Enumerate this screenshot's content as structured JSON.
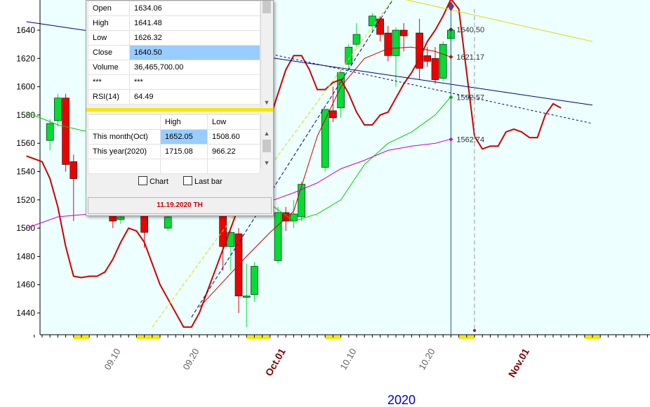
{
  "chart_data": {
    "type": "candlestick",
    "xlabel": "2020",
    "ylim": [
      1425,
      1662
    ],
    "y_ticks": [
      1440,
      1460,
      1480,
      1500,
      1520,
      1540,
      1560,
      1580,
      1600,
      1620,
      1640
    ],
    "x_ticks": [
      {
        "label": "09.10",
        "day": 10,
        "month": false
      },
      {
        "label": "09.20",
        "day": 20,
        "month": false
      },
      {
        "label": "Oct.01",
        "day": 31,
        "month": true
      },
      {
        "label": "10.10",
        "day": 40,
        "month": false
      },
      {
        "label": "10.20",
        "day": 50,
        "month": false
      },
      {
        "label": "Nov.01",
        "day": 62,
        "month": true
      }
    ],
    "candles": [
      {
        "day": 1,
        "open": 1562,
        "high": 1577,
        "low": 1555,
        "close": 1574
      },
      {
        "day": 2,
        "open": 1576,
        "high": 1595,
        "low": 1572,
        "close": 1592
      },
      {
        "day": 3,
        "open": 1592,
        "high": 1595,
        "low": 1540,
        "close": 1545
      },
      {
        "day": 4,
        "open": 1547,
        "high": 1552,
        "low": 1505,
        "close": 1535
      },
      {
        "day": 9,
        "open": 1509,
        "high": 1515,
        "low": 1500,
        "close": 1505
      },
      {
        "day": 10,
        "open": 1506,
        "high": 1512,
        "low": 1503,
        "close": 1508
      },
      {
        "day": 13,
        "open": 1510,
        "high": 1515,
        "low": 1486,
        "close": 1497
      },
      {
        "day": 16,
        "open": 1500,
        "high": 1512,
        "low": 1498,
        "close": 1508
      },
      {
        "day": 23,
        "open": 1513,
        "high": 1518,
        "low": 1470,
        "close": 1487
      },
      {
        "day": 24,
        "open": 1487,
        "high": 1498,
        "low": 1470,
        "close": 1497
      },
      {
        "day": 25,
        "open": 1496,
        "high": 1500,
        "low": 1440,
        "close": 1452
      },
      {
        "day": 26,
        "open": 1452,
        "high": 1475,
        "low": 1430,
        "close": 1452
      },
      {
        "day": 27,
        "open": 1453,
        "high": 1476,
        "low": 1448,
        "close": 1473
      },
      {
        "day": 30,
        "open": 1477,
        "high": 1515,
        "low": 1475,
        "close": 1511
      },
      {
        "day": 31,
        "open": 1511,
        "high": 1515,
        "low": 1498,
        "close": 1505
      },
      {
        "day": 32,
        "open": 1505,
        "high": 1520,
        "low": 1500,
        "close": 1510
      },
      {
        "day": 33,
        "open": 1508,
        "high": 1533,
        "low": 1505,
        "close": 1531
      },
      {
        "day": 36,
        "open": 1543,
        "high": 1575,
        "low": 1540,
        "close": 1584
      },
      {
        "day": 37,
        "open": 1583,
        "high": 1600,
        "low": 1575,
        "close": 1578
      },
      {
        "day": 38,
        "open": 1585,
        "high": 1612,
        "low": 1578,
        "close": 1610
      },
      {
        "day": 39,
        "open": 1616,
        "high": 1630,
        "low": 1612,
        "close": 1628
      },
      {
        "day": 40,
        "open": 1630,
        "high": 1645,
        "low": 1628,
        "close": 1637
      },
      {
        "day": 42,
        "open": 1643,
        "high": 1652,
        "low": 1638,
        "close": 1650
      },
      {
        "day": 43,
        "open": 1648,
        "high": 1650,
        "low": 1632,
        "close": 1637
      },
      {
        "day": 44,
        "open": 1638,
        "high": 1643,
        "low": 1618,
        "close": 1622
      },
      {
        "day": 45,
        "open": 1622,
        "high": 1642,
        "low": 1600,
        "close": 1640
      },
      {
        "day": 46,
        "open": 1640,
        "high": 1645,
        "low": 1625,
        "close": 1636
      },
      {
        "day": 48,
        "open": 1638,
        "high": 1648,
        "low": 1605,
        "close": 1613
      },
      {
        "day": 49,
        "open": 1622,
        "high": 1628,
        "low": 1614,
        "close": 1618
      },
      {
        "day": 50,
        "open": 1620,
        "high": 1628,
        "low": 1602,
        "close": 1605
      },
      {
        "day": 51,
        "open": 1606,
        "high": 1632,
        "low": 1604,
        "close": 1630
      },
      {
        "day": 52,
        "open": 1634,
        "high": 1641,
        "low": 1626,
        "close": 1640
      }
    ],
    "lines": [
      {
        "color": "#cc0000",
        "width": 2,
        "points": [
          [
            -2,
            1551
          ],
          [
            0,
            1547
          ],
          [
            1,
            1535
          ],
          [
            2,
            1515
          ],
          [
            3,
            1487
          ],
          [
            4,
            1466
          ],
          [
            5,
            1465
          ],
          [
            6,
            1466
          ],
          [
            7,
            1466
          ],
          [
            8,
            1469
          ],
          [
            9,
            1478
          ],
          [
            10,
            1490
          ],
          [
            11,
            1500
          ],
          [
            12,
            1498
          ],
          [
            13,
            1490
          ],
          [
            14,
            1475
          ],
          [
            15,
            1460
          ],
          [
            16,
            1450
          ],
          [
            17,
            1440
          ],
          [
            18,
            1430
          ],
          [
            19,
            1430
          ],
          [
            20,
            1440
          ],
          [
            21,
            1455
          ],
          [
            22,
            1470
          ],
          [
            23,
            1485
          ],
          [
            24,
            1500
          ],
          [
            25,
            1515
          ],
          [
            26,
            1530
          ],
          [
            27,
            1545
          ],
          [
            28,
            1560
          ],
          [
            29,
            1578
          ],
          [
            30,
            1595
          ],
          [
            31,
            1612
          ],
          [
            32,
            1622
          ],
          [
            33,
            1622
          ],
          [
            34,
            1612
          ],
          [
            35,
            1598
          ],
          [
            36,
            1598
          ],
          [
            37,
            1603
          ],
          [
            38,
            1605
          ],
          [
            39,
            1595
          ],
          [
            40,
            1582
          ],
          [
            41,
            1573
          ],
          [
            42,
            1573
          ],
          [
            43,
            1580
          ],
          [
            44,
            1582
          ],
          [
            45,
            1592
          ],
          [
            46,
            1602
          ],
          [
            47,
            1610
          ],
          [
            48,
            1620
          ],
          [
            49,
            1632
          ],
          [
            50,
            1640
          ],
          [
            51,
            1650
          ],
          [
            52,
            1662
          ],
          [
            53,
            1655
          ],
          [
            54,
            1610
          ],
          [
            55,
            1565
          ],
          [
            56,
            1556
          ],
          [
            57,
            1558
          ],
          [
            58,
            1558
          ],
          [
            59,
            1568
          ],
          [
            60,
            1570
          ],
          [
            61,
            1568
          ],
          [
            62,
            1564
          ],
          [
            63,
            1564
          ],
          [
            64,
            1580
          ],
          [
            65,
            1588
          ],
          [
            66,
            1585
          ]
        ]
      },
      {
        "color": "#cc0000",
        "width": 1,
        "points": [
          [
            20,
            1444
          ],
          [
            23,
            1462
          ],
          [
            26,
            1480
          ],
          [
            29,
            1497
          ],
          [
            32,
            1512
          ],
          [
            35,
            1565
          ],
          [
            38,
            1600
          ],
          [
            41,
            1620
          ],
          [
            44,
            1627
          ],
          [
            47,
            1628
          ],
          [
            50,
            1625
          ],
          [
            52,
            1621
          ]
        ]
      },
      {
        "color": "#00cc00",
        "width": 1,
        "points": [
          [
            -2,
            1582
          ],
          [
            2,
            1573
          ],
          [
            6,
            1568
          ],
          [
            10,
            1560
          ],
          [
            14,
            1550
          ],
          [
            18,
            1540
          ],
          [
            22,
            1532
          ],
          [
            26,
            1525
          ],
          [
            29,
            1517
          ],
          [
            32,
            1505
          ],
          [
            35,
            1510
          ],
          [
            38,
            1520
          ],
          [
            41,
            1545
          ],
          [
            44,
            1560
          ],
          [
            47,
            1568
          ],
          [
            50,
            1580
          ],
          [
            52,
            1593
          ]
        ]
      },
      {
        "color": "#cc00cc",
        "width": 1,
        "points": [
          [
            -2,
            1500
          ],
          [
            2,
            1508
          ],
          [
            6,
            1510
          ],
          [
            10,
            1511
          ],
          [
            14,
            1512
          ],
          [
            18,
            1512
          ],
          [
            22,
            1513
          ],
          [
            26,
            1516
          ],
          [
            29,
            1519
          ],
          [
            32,
            1525
          ],
          [
            35,
            1532
          ],
          [
            38,
            1542
          ],
          [
            41,
            1548
          ],
          [
            44,
            1555
          ],
          [
            47,
            1558
          ],
          [
            50,
            1560
          ],
          [
            52,
            1563
          ]
        ]
      },
      {
        "color": "#000080",
        "width": 1,
        "points": [
          [
            -2,
            1646
          ],
          [
            70,
            1587
          ]
        ]
      },
      {
        "color": "#dddd00",
        "width": 1,
        "points": [
          [
            25,
            1688
          ],
          [
            70,
            1632
          ]
        ]
      },
      {
        "color": "#000080",
        "width": 1,
        "dash": "3,3",
        "points": [
          [
            25,
            1628
          ],
          [
            70,
            1574
          ]
        ]
      },
      {
        "color": "#dddd00",
        "width": 1,
        "dash": "5,3",
        "points": [
          [
            14,
            1430
          ],
          [
            45,
            1665
          ]
        ]
      },
      {
        "color": "#000080",
        "width": 1,
        "dash": "5,3",
        "points": [
          [
            19,
            1437
          ],
          [
            45,
            1665
          ]
        ]
      }
    ],
    "markers": [
      {
        "day": 52,
        "value": 1640.5,
        "label": "1640.50",
        "color": "#333333"
      },
      {
        "day": 52,
        "value": 1621.17,
        "label": "1621.17",
        "color": "#cc0000"
      },
      {
        "day": 52,
        "value": 1592.57,
        "label": "1592.57",
        "color": "#00aa00"
      },
      {
        "day": 52,
        "value": 1562.74,
        "label": "1562.74",
        "color": "#cc00cc"
      }
    ],
    "cursor_day": 52,
    "projection_day": 55,
    "colors": {
      "plot_bg": "#eeffff",
      "up": "#00dd33",
      "down": "#ee0000",
      "axis_text": "#606060",
      "month_text": "#800000",
      "year_text": "#0000cc",
      "holiday": "#f5e800"
    }
  },
  "panel": {
    "rows": [
      {
        "label": "Open",
        "value": "1634.06"
      },
      {
        "label": "High",
        "value": "1641.48"
      },
      {
        "label": "Low",
        "value": "1626.32"
      },
      {
        "label": "Close",
        "value": "1640.50"
      },
      {
        "label": "Volume",
        "value": "36,465,700.00"
      },
      {
        "label": "***",
        "value": "***"
      },
      {
        "label": "RSI(14)",
        "value": "64.49"
      }
    ],
    "range_header": {
      "high": "High",
      "low": "Low"
    },
    "ranges": [
      {
        "label": "This month(Oct)",
        "high": "1652.05",
        "low": "1508.60"
      },
      {
        "label": "This year(2020)",
        "high": "1715.08",
        "low": "966.22"
      }
    ],
    "chart_checkbox": "Chart",
    "lastbar_checkbox": "Last bar",
    "date": "11.19.2020 TH"
  }
}
